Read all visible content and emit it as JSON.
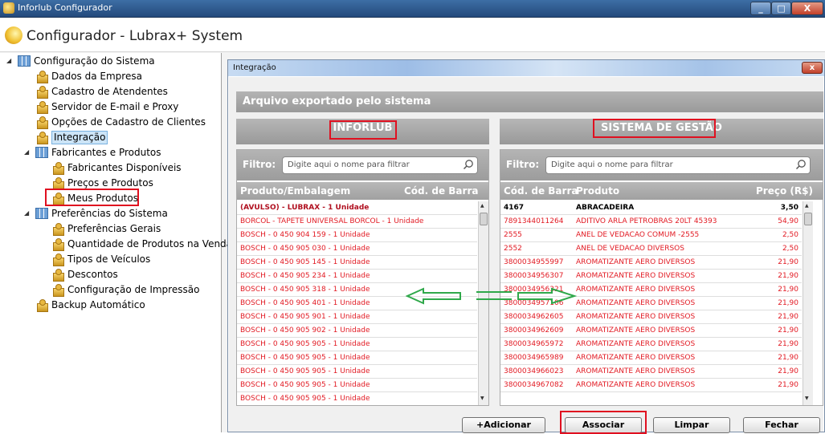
{
  "window": {
    "title": "Inforlub Configurador",
    "min": "_",
    "max": "□",
    "close": "X"
  },
  "app": {
    "title": "Configurador - Lubrax+ System"
  },
  "tree": {
    "root": "Configuração do Sistema",
    "items": [
      {
        "label": "Dados da Empresa"
      },
      {
        "label": "Cadastro de Atendentes"
      },
      {
        "label": "Servidor de E-mail e Proxy"
      },
      {
        "label": "Opções de Cadastro de Clientes"
      },
      {
        "label": "Integração"
      }
    ],
    "group2": "Fabricantes e Produtos",
    "group2_items": [
      {
        "label": "Fabricantes Disponíveis"
      },
      {
        "label": "Preços e Produtos"
      },
      {
        "label": "Meus Produtos"
      }
    ],
    "group3": "Preferências do Sistema",
    "group3_items": [
      {
        "label": "Preferências Gerais"
      },
      {
        "label": "Quantidade de Produtos na Venda"
      },
      {
        "label": "Tipos de Veículos"
      },
      {
        "label": "Descontos"
      },
      {
        "label": "Configuração de Impressão"
      }
    ],
    "backup": "Backup Automático"
  },
  "dialog": {
    "title": "Integração",
    "close": "x",
    "header": "Arquivo exportado pelo sistema",
    "left_title": "INFORLUB",
    "right_title": "SISTEMA DE GESTÃO",
    "filter_label": "Filtro:",
    "left_placeholder": "Digite aqui o nome para filtrar",
    "right_placeholder": "Digite aqui o nome para filtrar",
    "left_cols": {
      "produto": "Produto/Embalagem",
      "codigo": "Cód. de Barra"
    },
    "right_cols": {
      "codigo": "Cód. de Barra",
      "produto": "Produto",
      "preco": "Preço (R$)"
    },
    "left_rows": [
      "(AVULSO) - LUBRAX - 1 Unidade",
      "BORCOL - TAPETE UNIVERSAL BORCOL - 1 Unidade",
      "BOSCH - 0 450 904 159 - 1 Unidade",
      "BOSCH - 0 450 905 030 - 1 Unidade",
      "BOSCH - 0 450 905 145 - 1 Unidade",
      "BOSCH - 0 450 905 234 - 1 Unidade",
      "BOSCH - 0 450 905 318 - 1 Unidade",
      "BOSCH - 0 450 905 401 - 1 Unidade",
      "BOSCH - 0 450 905 901 - 1 Unidade",
      "BOSCH - 0 450 905 902 - 1 Unidade",
      "BOSCH - 0 450 905 905 - 1 Unidade",
      "BOSCH - 0 450 905 905 - 1 Unidade",
      "BOSCH - 0 450 905 905 - 1 Unidade",
      "BOSCH - 0 450 905 905 - 1 Unidade",
      "BOSCH - 0 450 905 905 - 1 Unidade"
    ],
    "right_rows": [
      {
        "cod": "4167",
        "prod": "ABRACADEIRA",
        "preco": "3,50"
      },
      {
        "cod": "7891344011264",
        "prod": "ADITIVO ARLA PETROBRAS 20LT 45393",
        "preco": "54,90"
      },
      {
        "cod": "2555",
        "prod": "ANEL DE VEDACAO COMUM -2555",
        "preco": "2,50"
      },
      {
        "cod": "2552",
        "prod": "ANEL DE VEDACAO DIVERSOS",
        "preco": "2,50"
      },
      {
        "cod": "3800034955997",
        "prod": "AROMATIZANTE AERO DIVERSOS",
        "preco": "21,90"
      },
      {
        "cod": "3800034956307",
        "prod": "AROMATIZANTE AERO DIVERSOS",
        "preco": "21,90"
      },
      {
        "cod": "3800034956321",
        "prod": "AROMATIZANTE AERO DIVERSOS",
        "preco": "21,90"
      },
      {
        "cod": "3800034957106",
        "prod": "AROMATIZANTE AERO DIVERSOS",
        "preco": "21,90"
      },
      {
        "cod": "3800034962605",
        "prod": "AROMATIZANTE AERO DIVERSOS",
        "preco": "21,90"
      },
      {
        "cod": "3800034962609",
        "prod": "AROMATIZANTE AERO DIVERSOS",
        "preco": "21,90"
      },
      {
        "cod": "3800034965972",
        "prod": "AROMATIZANTE AERO DIVERSOS",
        "preco": "21,90"
      },
      {
        "cod": "3800034965989",
        "prod": "AROMATIZANTE AERO DIVERSOS",
        "preco": "21,90"
      },
      {
        "cod": "3800034966023",
        "prod": "AROMATIZANTE AERO DIVERSOS",
        "preco": "21,90"
      },
      {
        "cod": "3800034967082",
        "prod": "AROMATIZANTE AERO DIVERSOS",
        "preco": "21,90"
      }
    ],
    "buttons": {
      "adicionar": "+Adicionar",
      "associar": "Associar",
      "limpar": "Limpar",
      "fechar": "Fechar"
    }
  },
  "colors": {
    "accent_red": "#e01020",
    "arrow_green": "#2fa84a",
    "row_red": "#e21a23"
  }
}
